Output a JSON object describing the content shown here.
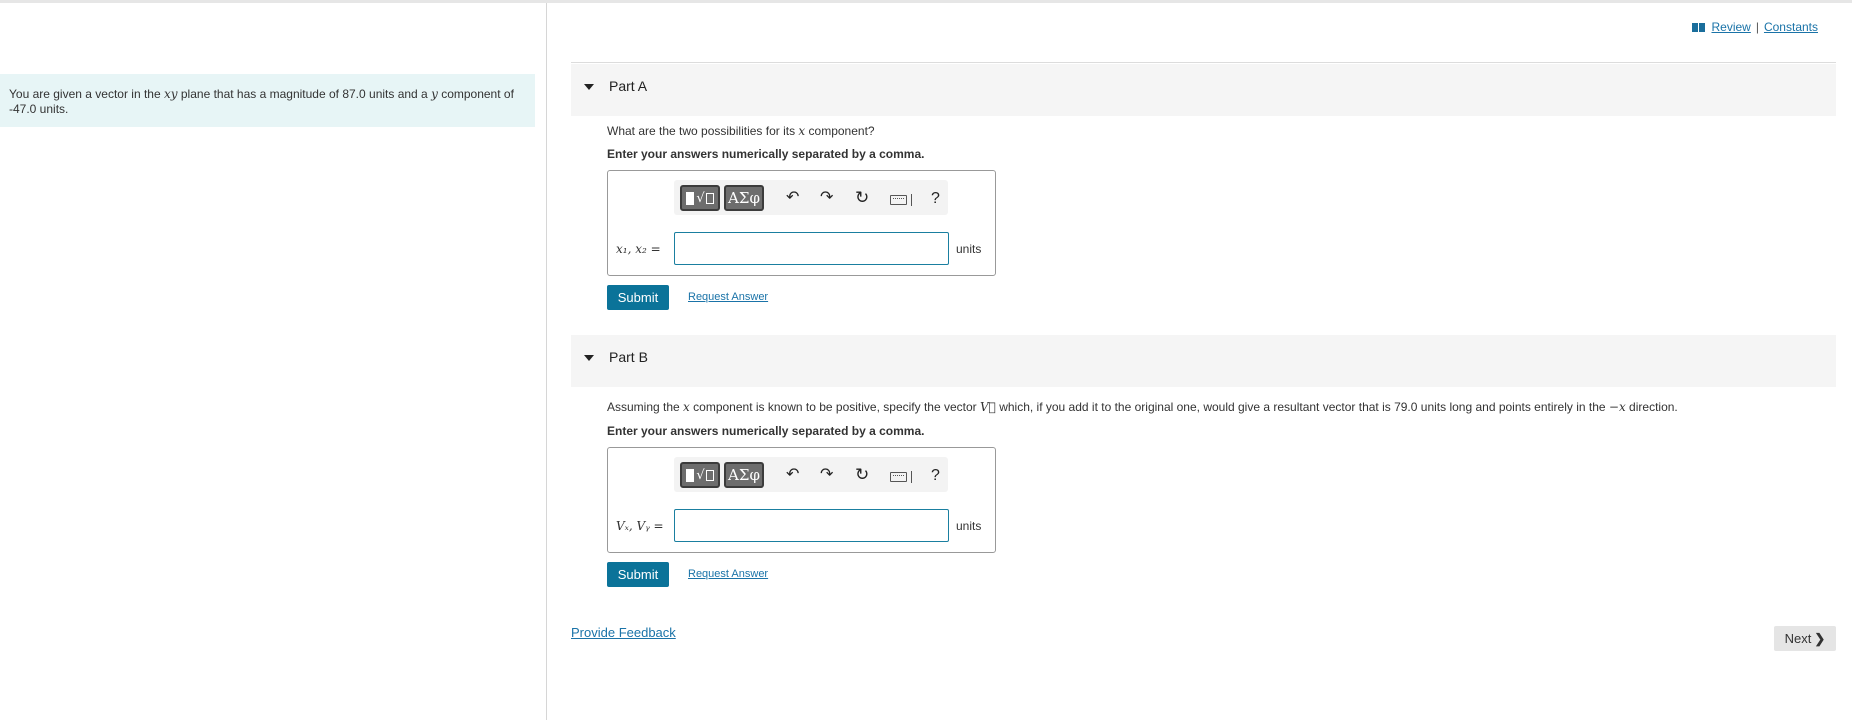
{
  "header": {
    "review_label": "Review",
    "separator": "|",
    "constants_label": "Constants"
  },
  "intro": {
    "text_before": "You are given a vector in the ",
    "plane_symbol": "xy",
    "text_middle": " plane that has a magnitude of 87.0 units and a ",
    "y_symbol": "y",
    "text_after": " component of",
    "line2": "-47.0 units."
  },
  "parts": [
    {
      "title": "Part A",
      "question_before": "What are the two possibilities for its ",
      "question_symbol": "x",
      "question_after": " component?",
      "instruction": "Enter your answers numerically separated by a comma.",
      "variable_label": "x₁, x₂ =",
      "input_value": "",
      "units": "units",
      "submit_label": "Submit",
      "request_label": "Request Answer"
    },
    {
      "title": "Part B",
      "question_before": "Assuming the ",
      "question_symbol": "x",
      "question_mid": " component is known to be positive, specify the vector ",
      "vector_symbol": "V⃗",
      "question_after": " which, if you add it to the original one, would give a resultant vector that is 79.0 units long and points entirely in the ",
      "direction_symbol": "−x",
      "question_end": " direction.",
      "instruction": "Enter your answers numerically separated by a comma.",
      "variable_label": "Vₓ, Vᵧ =",
      "input_value": "",
      "units": "units",
      "submit_label": "Submit",
      "request_label": "Request Answer"
    }
  ],
  "toolbar": {
    "greek_label": "ΑΣφ",
    "undo_glyph": "↶",
    "redo_glyph": "↷",
    "reset_glyph": "↻",
    "help_glyph": "?"
  },
  "footer": {
    "feedback_label": "Provide Feedback",
    "next_label": "Next",
    "next_chevron": "❯"
  }
}
